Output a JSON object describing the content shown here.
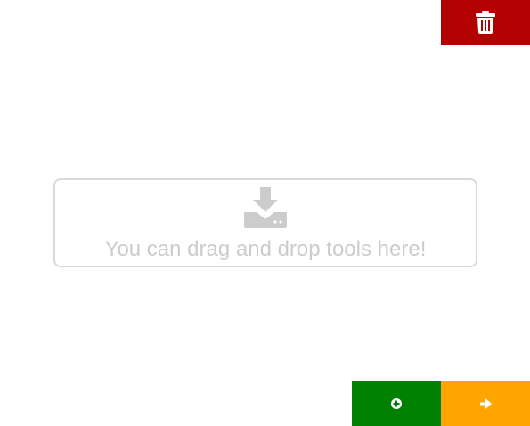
{
  "toolbar": {
    "delete_icon": "trash-icon"
  },
  "drop_zone": {
    "icon": "download-drive-icon",
    "message": "You can drag and drop tools here!"
  },
  "actions": {
    "add_icon": "plus-circle-icon",
    "next_icon": "arrow-right-icon"
  },
  "colors": {
    "delete": "#b30000",
    "add": "#008000",
    "next": "#ffa500",
    "drop_border": "#d9d9d9",
    "drop_text": "#cccccc"
  }
}
